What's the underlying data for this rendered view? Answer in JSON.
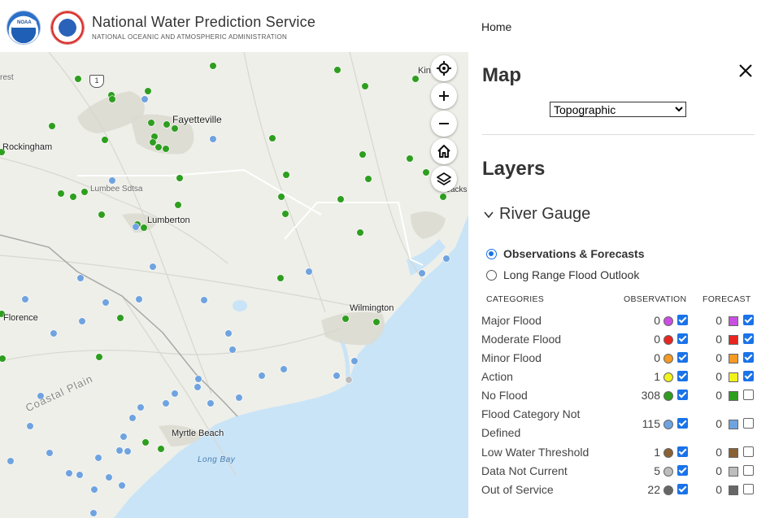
{
  "header": {
    "logo_noaa": "NOAA",
    "title": "National Water Prediction Service",
    "subtitle": "NATIONAL OCEANIC AND ATMOSPHERIC ADMINISTRATION",
    "nav_home": "Home"
  },
  "map": {
    "route_shield": "1",
    "places": {
      "rest": "rest",
      "kin": "Kin",
      "fayetteville": "Fayetteville",
      "rockingham": "Rockingham",
      "lumbee": "Lumbee Sdtsa",
      "lumberton": "Lumberton",
      "jacks": "Jacks",
      "wilmington": "Wilmington",
      "florence": "Florence",
      "coastal_plain": "Coastal Plain",
      "myrtle_beach": "Myrtle Beach",
      "long_bay": "Long Bay"
    },
    "colors": {
      "land": "#eeefe9",
      "water": "#c9e4f7",
      "urban": "#dcdad2",
      "gauge_no_flood": "#2e9e1f",
      "gauge_not_defined": "#6fa3e0",
      "gauge_not_current": "#bdbdbd"
    },
    "controls": [
      "locate-icon",
      "zoom-in-icon",
      "zoom-out-icon",
      "home-icon",
      "layers-icon"
    ]
  },
  "panel": {
    "map_title": "Map",
    "basemap_selected": "Topographic",
    "layers_title": "Layers",
    "section_label": "River Gauge",
    "radio_observations": "Observations & Forecasts",
    "radio_long_range": "Long Range Flood Outlook",
    "col_categories": "CATEGORIES",
    "col_observation": "OBSERVATION",
    "col_forecast": "FORECAST",
    "categories": [
      {
        "label": "Major Flood",
        "obs": "0",
        "fcst": "0",
        "color": "#c94fe0",
        "obs_checked": true,
        "fcst_checked": true
      },
      {
        "label": "Moderate Flood",
        "obs": "0",
        "fcst": "0",
        "color": "#e8261f",
        "obs_checked": true,
        "fcst_checked": true
      },
      {
        "label": "Minor Flood",
        "obs": "0",
        "fcst": "0",
        "color": "#f59a24",
        "obs_checked": true,
        "fcst_checked": true
      },
      {
        "label": "Action",
        "obs": "1",
        "fcst": "0",
        "color": "#f2f21c",
        "obs_checked": true,
        "fcst_checked": true
      },
      {
        "label": "No Flood",
        "obs": "308",
        "fcst": "0",
        "color": "#2e9e1f",
        "obs_checked": true,
        "fcst_checked": false
      },
      {
        "label": "Flood Category Not Defined",
        "obs": "115",
        "fcst": "0",
        "color": "#6fa3e0",
        "obs_checked": true,
        "fcst_checked": false
      },
      {
        "label": "Low Water Threshold",
        "obs": "1",
        "fcst": "0",
        "color": "#8a6134",
        "obs_checked": true,
        "fcst_checked": false
      },
      {
        "label": "Data Not Current",
        "obs": "5",
        "fcst": "0",
        "color": "#bdbdbd",
        "obs_checked": true,
        "fcst_checked": false
      },
      {
        "label": "Out of Service",
        "obs": "22",
        "fcst": "0",
        "color": "#666666",
        "obs_checked": true,
        "fcst_checked": false
      }
    ]
  }
}
